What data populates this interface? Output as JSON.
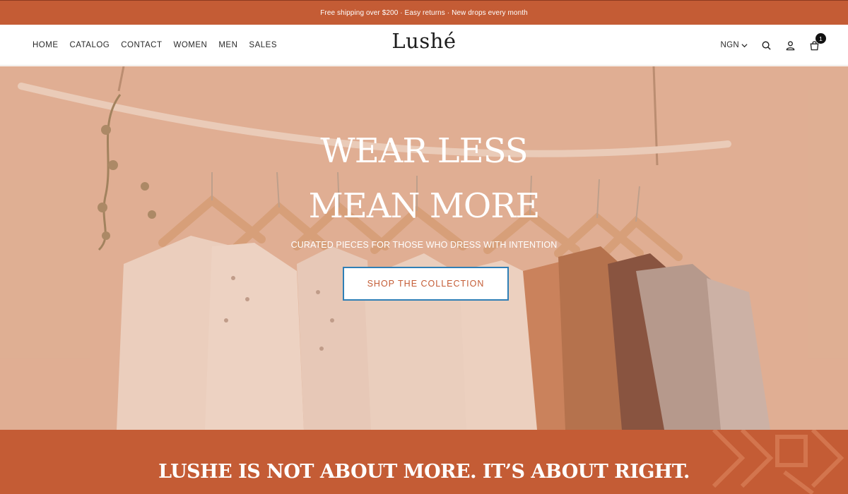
{
  "announcement": "Free shipping over $200 · Easy returns · New drops every month",
  "nav": {
    "items": [
      "HOME",
      "CATALOG",
      "CONTACT",
      "WOMEN",
      "MEN",
      "SALES"
    ]
  },
  "brand": {
    "logo": "Lushé"
  },
  "tools": {
    "currency": "NGN",
    "cart_count": "1"
  },
  "hero": {
    "title_line1": "WEAR LESS",
    "title_line2": "MEAN MORE",
    "subtitle": "CURATED PIECES FOR THOSE WHO DRESS WITH INTENTION",
    "cta": "SHOP THE COLLECTION"
  },
  "band": {
    "text": "LUSHE IS NOT ABOUT MORE. IT’S ABOUT RIGHT."
  },
  "colors": {
    "accent": "#c45c35",
    "cta_border": "#2f7fb6"
  },
  "icons": [
    "chevron-down-icon",
    "search-icon",
    "user-icon",
    "cart-icon"
  ]
}
